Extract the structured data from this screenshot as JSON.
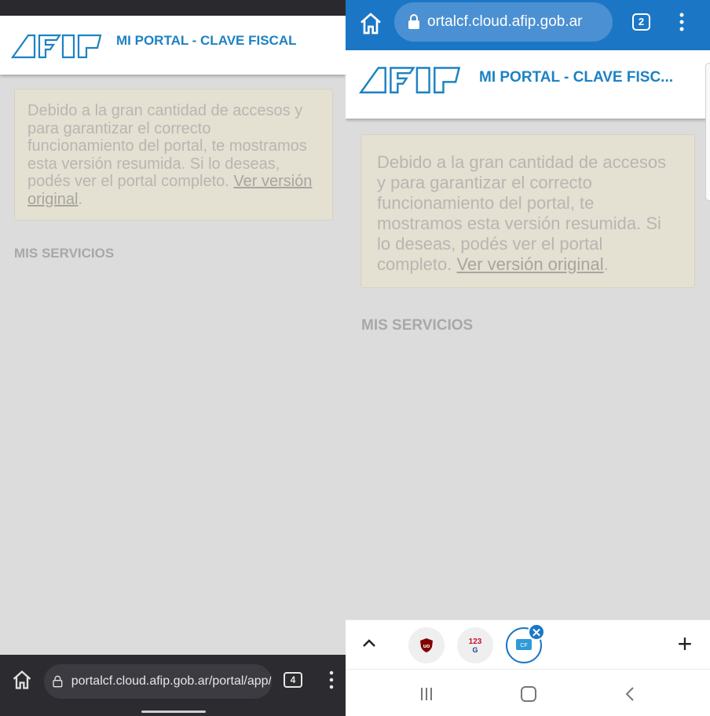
{
  "left": {
    "brand_title": "MI PORTAL - CLAVE FISCAL",
    "notice_text": "Debido a la gran cantidad de accesos y para garantizar el correcto funcionamiento del portal, te mostramos esta versión resumida. Si lo deseas, podés ver el portal completo. ",
    "notice_link": "Ver versión original",
    "notice_end": ".",
    "services_title": "MIS SERVICIOS",
    "url": "portalcf.cloud.afip.gob.ar/portal/app/",
    "tab_count": "4"
  },
  "right": {
    "url": "ortalcf.cloud.afip.gob.ar",
    "tab_count": "2",
    "brand_title": "MI PORTAL - CLAVE FISC...",
    "notice_text": "Debido a la gran cantidad de accesos y para garantizar el correcto funcionamiento del portal, te mostramos esta versión resumida. Si lo deseas, podés ver el portal completo. ",
    "notice_link": "Ver versión original",
    "notice_end": ".",
    "services_title": "MIS SERVICIOS",
    "tabs": [
      {
        "icon": "ublock-origin-icon",
        "label": "uo"
      },
      {
        "icon": "calculator-123-icon",
        "label": "123"
      },
      {
        "icon": "clave-fiscal-icon",
        "label": "CF"
      }
    ],
    "close_glyph": "✕",
    "plus_glyph": "+"
  },
  "colors": {
    "afip_blue": "#1d82c3",
    "chrome_blue": "#1b77c5",
    "notice_bg": "#e4e0d2",
    "page_bg": "#dcdcdc",
    "dark_bar": "#2b2b30"
  }
}
